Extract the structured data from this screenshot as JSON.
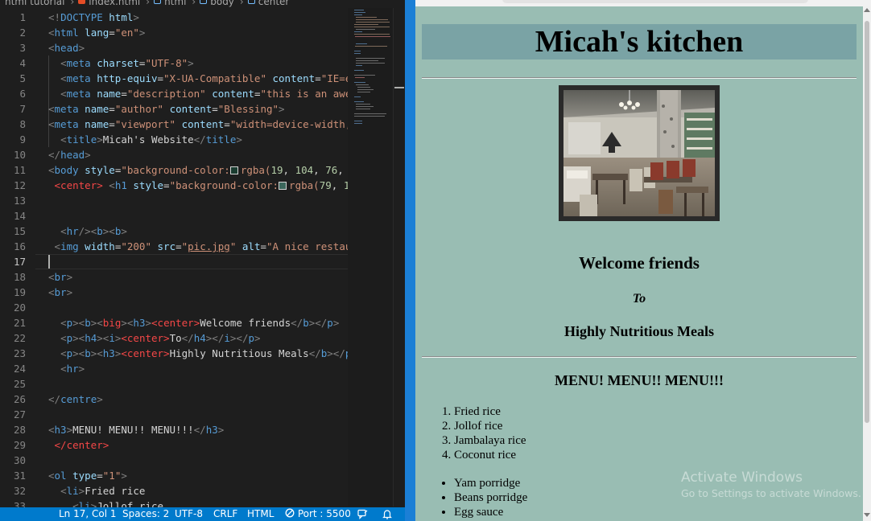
{
  "breadcrumb": [
    "html tutorial",
    "index.html",
    "html",
    "body",
    "center"
  ],
  "editor": {
    "line_numbers": [
      "1",
      "2",
      "3",
      "4",
      "5",
      "6",
      "7",
      "8",
      "9",
      "10",
      "11",
      "12",
      "13",
      "14",
      "15",
      "16",
      "17",
      "18",
      "19",
      "20",
      "21",
      "22",
      "23",
      "24",
      "25",
      "26",
      "27",
      "28",
      "29",
      "30",
      "31",
      "32",
      "33"
    ],
    "active_line": "17"
  },
  "statusbar": {
    "position": "Ln 17, Col 1",
    "spaces": "Spaces: 2",
    "encoding": "UTF-8",
    "eol": "CRLF",
    "language": "HTML",
    "port": "Port : 5500"
  },
  "colors": {
    "status_bar": "#007acc",
    "page_background": "#99bdb3",
    "title_background": "#7aa3a5"
  },
  "page": {
    "title": "Micah's kitchen",
    "image_alt": "A nice restaurant",
    "welcome": "Welcome friends",
    "to": "To",
    "meals": "Highly Nutritious Meals",
    "menu_heading": "MENU! MENU!! MENU!!!",
    "ordered_items": [
      "Fried rice",
      "Jollof rice",
      "Jambalaya rice",
      "Coconut rice"
    ],
    "bullet_items": [
      "Yam porridge",
      "Beans porridge",
      "Egg sauce"
    ]
  },
  "watermark": {
    "line1": "Activate Windows",
    "line2": "Go to Settings to activate Windows."
  }
}
